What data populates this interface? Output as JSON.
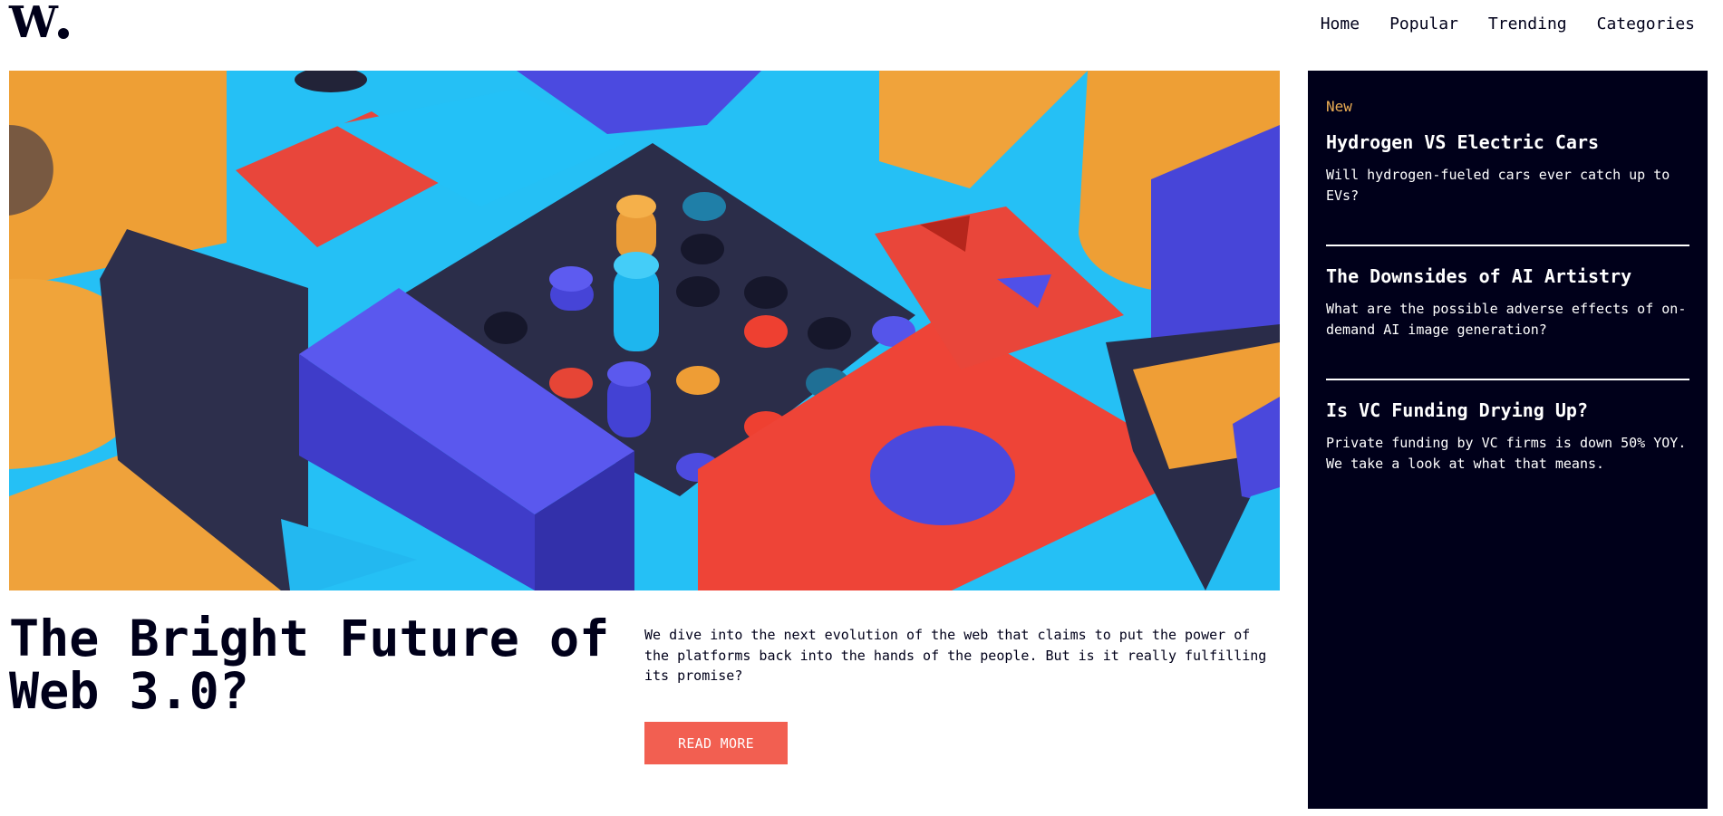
{
  "brand": {
    "letter": "W"
  },
  "nav": {
    "items": [
      {
        "label": "Home"
      },
      {
        "label": "Popular"
      },
      {
        "label": "Trending"
      },
      {
        "label": "Categories"
      }
    ]
  },
  "hero": {
    "image_alt": "Colorful 3D geometric wooden blocks",
    "colors": {
      "orange": "#f0a43a",
      "blue": "#4f4ee6",
      "cyan": "#24bff5",
      "red": "#ef4437",
      "navy": "#2a2c49"
    }
  },
  "article": {
    "title": "The Bright Future of Web 3.0?",
    "excerpt": "We dive into the next evolution of the web that claims to put the power of the platforms back into the hands of the people. But is it really fulfilling its promise?",
    "read_more_label": "READ MORE",
    "accent_color": "#f25f51"
  },
  "sidebar": {
    "tag": "New",
    "background": "#00001a",
    "tag_color": "#e9ab53",
    "items": [
      {
        "title": "Hydrogen VS Electric Cars",
        "desc": "Will hydrogen-fueled cars ever catch up to EVs?"
      },
      {
        "title": "The Downsides of AI Artistry",
        "desc": "What are the possible adverse effects of on-demand AI image generation?"
      },
      {
        "title": "Is VC Funding Drying Up?",
        "desc": "Private funding by VC firms is down 50% YOY. We take a look at what that means."
      }
    ]
  }
}
